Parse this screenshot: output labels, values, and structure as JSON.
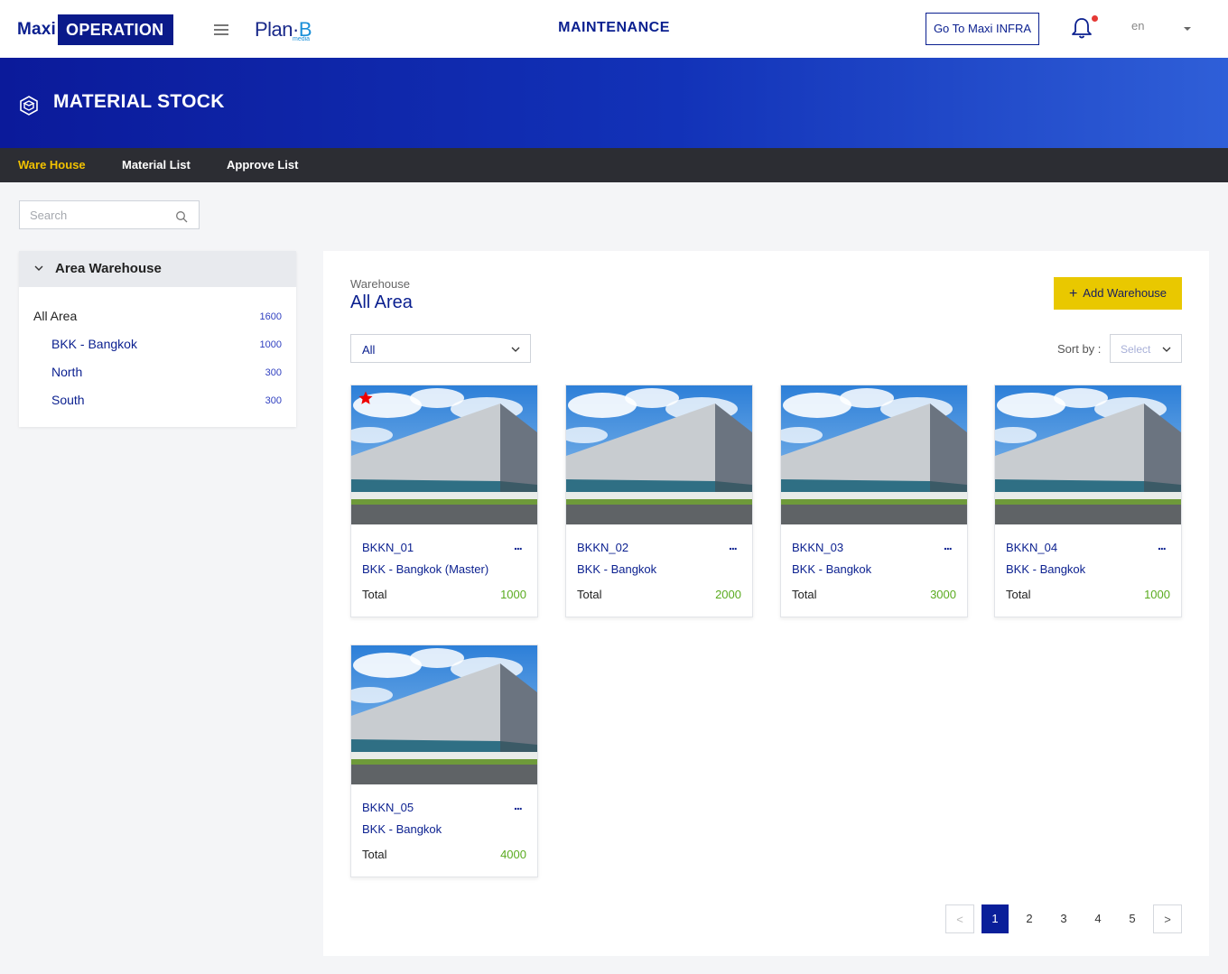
{
  "header": {
    "logo_maxi": "Maxi",
    "logo_operation": "OPERATION",
    "partner_logo_plan": "Plan",
    "partner_logo_b": "B",
    "partner_logo_sub": "media",
    "title": "MAINTENANCE",
    "infra_button": "Go To Maxi INFRA",
    "language": "en",
    "icons": [
      "menu-icon",
      "bell-icon",
      "chevron-down-icon"
    ],
    "notification_dot_color": "#e53935"
  },
  "banner": {
    "title": "MATERIAL STOCK",
    "icon": "box-icon"
  },
  "nav": {
    "tabs": [
      {
        "label": "Ware House",
        "active": true
      },
      {
        "label": "Material List",
        "active": false
      },
      {
        "label": "Approve List",
        "active": false
      }
    ]
  },
  "sidebar": {
    "search_placeholder": "Search",
    "panel_title": "Area Warehouse",
    "areas": [
      {
        "label": "All  Area",
        "count": "1600"
      },
      {
        "label": "BKK  -  Bangkok",
        "count": "1000"
      },
      {
        "label": "North",
        "count": "300"
      },
      {
        "label": "South",
        "count": "300"
      }
    ]
  },
  "main": {
    "section_label": "Warehouse",
    "section_title": "All Area",
    "add_button": "Add Warehouse",
    "filter_value": "All",
    "sort_label": "Sort by :",
    "sort_placeholder": "Select",
    "cards": [
      {
        "code": "BKKN_01",
        "location": "BKK  -  Bangkok (Master)",
        "total_label": "Total",
        "total": "1000",
        "starred": true
      },
      {
        "code": "BKKN_02",
        "location": "BKK  -  Bangkok",
        "total_label": "Total",
        "total": "2000",
        "starred": false
      },
      {
        "code": "BKKN_03",
        "location": "BKK  -  Bangkok",
        "total_label": "Total",
        "total": "3000",
        "starred": false
      },
      {
        "code": "BKKN_04",
        "location": "BKK  -  Bangkok",
        "total_label": "Total",
        "total": "1000",
        "starred": false
      },
      {
        "code": "BKKN_05",
        "location": "BKK  -  Bangkok",
        "total_label": "Total",
        "total": "4000",
        "starred": false
      }
    ],
    "more_label": "...",
    "pagination": {
      "prev": "<",
      "pages": [
        "1",
        "2",
        "3",
        "4",
        "5"
      ],
      "current": "1",
      "next": ">"
    }
  },
  "colors": {
    "brand_navy": "#0a1f8f",
    "accent_yellow": "#e9c800",
    "nav_active": "#f2c200",
    "total_green": "#5aab1f"
  }
}
